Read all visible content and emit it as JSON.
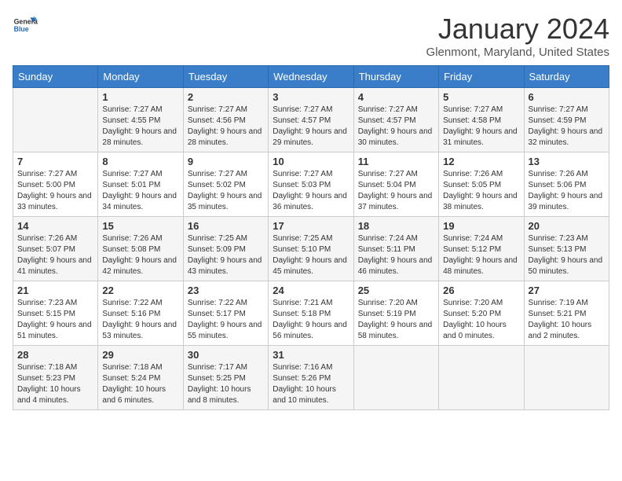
{
  "header": {
    "logo_general": "General",
    "logo_blue": "Blue",
    "title": "January 2024",
    "subtitle": "Glenmont, Maryland, United States"
  },
  "weekdays": [
    "Sunday",
    "Monday",
    "Tuesday",
    "Wednesday",
    "Thursday",
    "Friday",
    "Saturday"
  ],
  "weeks": [
    [
      {
        "day": "",
        "sunrise": "",
        "sunset": "",
        "daylight": ""
      },
      {
        "day": "1",
        "sunrise": "Sunrise: 7:27 AM",
        "sunset": "Sunset: 4:55 PM",
        "daylight": "Daylight: 9 hours and 28 minutes."
      },
      {
        "day": "2",
        "sunrise": "Sunrise: 7:27 AM",
        "sunset": "Sunset: 4:56 PM",
        "daylight": "Daylight: 9 hours and 28 minutes."
      },
      {
        "day": "3",
        "sunrise": "Sunrise: 7:27 AM",
        "sunset": "Sunset: 4:57 PM",
        "daylight": "Daylight: 9 hours and 29 minutes."
      },
      {
        "day": "4",
        "sunrise": "Sunrise: 7:27 AM",
        "sunset": "Sunset: 4:57 PM",
        "daylight": "Daylight: 9 hours and 30 minutes."
      },
      {
        "day": "5",
        "sunrise": "Sunrise: 7:27 AM",
        "sunset": "Sunset: 4:58 PM",
        "daylight": "Daylight: 9 hours and 31 minutes."
      },
      {
        "day": "6",
        "sunrise": "Sunrise: 7:27 AM",
        "sunset": "Sunset: 4:59 PM",
        "daylight": "Daylight: 9 hours and 32 minutes."
      }
    ],
    [
      {
        "day": "7",
        "sunrise": "Sunrise: 7:27 AM",
        "sunset": "Sunset: 5:00 PM",
        "daylight": "Daylight: 9 hours and 33 minutes."
      },
      {
        "day": "8",
        "sunrise": "Sunrise: 7:27 AM",
        "sunset": "Sunset: 5:01 PM",
        "daylight": "Daylight: 9 hours and 34 minutes."
      },
      {
        "day": "9",
        "sunrise": "Sunrise: 7:27 AM",
        "sunset": "Sunset: 5:02 PM",
        "daylight": "Daylight: 9 hours and 35 minutes."
      },
      {
        "day": "10",
        "sunrise": "Sunrise: 7:27 AM",
        "sunset": "Sunset: 5:03 PM",
        "daylight": "Daylight: 9 hours and 36 minutes."
      },
      {
        "day": "11",
        "sunrise": "Sunrise: 7:27 AM",
        "sunset": "Sunset: 5:04 PM",
        "daylight": "Daylight: 9 hours and 37 minutes."
      },
      {
        "day": "12",
        "sunrise": "Sunrise: 7:26 AM",
        "sunset": "Sunset: 5:05 PM",
        "daylight": "Daylight: 9 hours and 38 minutes."
      },
      {
        "day": "13",
        "sunrise": "Sunrise: 7:26 AM",
        "sunset": "Sunset: 5:06 PM",
        "daylight": "Daylight: 9 hours and 39 minutes."
      }
    ],
    [
      {
        "day": "14",
        "sunrise": "Sunrise: 7:26 AM",
        "sunset": "Sunset: 5:07 PM",
        "daylight": "Daylight: 9 hours and 41 minutes."
      },
      {
        "day": "15",
        "sunrise": "Sunrise: 7:26 AM",
        "sunset": "Sunset: 5:08 PM",
        "daylight": "Daylight: 9 hours and 42 minutes."
      },
      {
        "day": "16",
        "sunrise": "Sunrise: 7:25 AM",
        "sunset": "Sunset: 5:09 PM",
        "daylight": "Daylight: 9 hours and 43 minutes."
      },
      {
        "day": "17",
        "sunrise": "Sunrise: 7:25 AM",
        "sunset": "Sunset: 5:10 PM",
        "daylight": "Daylight: 9 hours and 45 minutes."
      },
      {
        "day": "18",
        "sunrise": "Sunrise: 7:24 AM",
        "sunset": "Sunset: 5:11 PM",
        "daylight": "Daylight: 9 hours and 46 minutes."
      },
      {
        "day": "19",
        "sunrise": "Sunrise: 7:24 AM",
        "sunset": "Sunset: 5:12 PM",
        "daylight": "Daylight: 9 hours and 48 minutes."
      },
      {
        "day": "20",
        "sunrise": "Sunrise: 7:23 AM",
        "sunset": "Sunset: 5:13 PM",
        "daylight": "Daylight: 9 hours and 50 minutes."
      }
    ],
    [
      {
        "day": "21",
        "sunrise": "Sunrise: 7:23 AM",
        "sunset": "Sunset: 5:15 PM",
        "daylight": "Daylight: 9 hours and 51 minutes."
      },
      {
        "day": "22",
        "sunrise": "Sunrise: 7:22 AM",
        "sunset": "Sunset: 5:16 PM",
        "daylight": "Daylight: 9 hours and 53 minutes."
      },
      {
        "day": "23",
        "sunrise": "Sunrise: 7:22 AM",
        "sunset": "Sunset: 5:17 PM",
        "daylight": "Daylight: 9 hours and 55 minutes."
      },
      {
        "day": "24",
        "sunrise": "Sunrise: 7:21 AM",
        "sunset": "Sunset: 5:18 PM",
        "daylight": "Daylight: 9 hours and 56 minutes."
      },
      {
        "day": "25",
        "sunrise": "Sunrise: 7:20 AM",
        "sunset": "Sunset: 5:19 PM",
        "daylight": "Daylight: 9 hours and 58 minutes."
      },
      {
        "day": "26",
        "sunrise": "Sunrise: 7:20 AM",
        "sunset": "Sunset: 5:20 PM",
        "daylight": "Daylight: 10 hours and 0 minutes."
      },
      {
        "day": "27",
        "sunrise": "Sunrise: 7:19 AM",
        "sunset": "Sunset: 5:21 PM",
        "daylight": "Daylight: 10 hours and 2 minutes."
      }
    ],
    [
      {
        "day": "28",
        "sunrise": "Sunrise: 7:18 AM",
        "sunset": "Sunset: 5:23 PM",
        "daylight": "Daylight: 10 hours and 4 minutes."
      },
      {
        "day": "29",
        "sunrise": "Sunrise: 7:18 AM",
        "sunset": "Sunset: 5:24 PM",
        "daylight": "Daylight: 10 hours and 6 minutes."
      },
      {
        "day": "30",
        "sunrise": "Sunrise: 7:17 AM",
        "sunset": "Sunset: 5:25 PM",
        "daylight": "Daylight: 10 hours and 8 minutes."
      },
      {
        "day": "31",
        "sunrise": "Sunrise: 7:16 AM",
        "sunset": "Sunset: 5:26 PM",
        "daylight": "Daylight: 10 hours and 10 minutes."
      },
      {
        "day": "",
        "sunrise": "",
        "sunset": "",
        "daylight": ""
      },
      {
        "day": "",
        "sunrise": "",
        "sunset": "",
        "daylight": ""
      },
      {
        "day": "",
        "sunrise": "",
        "sunset": "",
        "daylight": ""
      }
    ]
  ]
}
